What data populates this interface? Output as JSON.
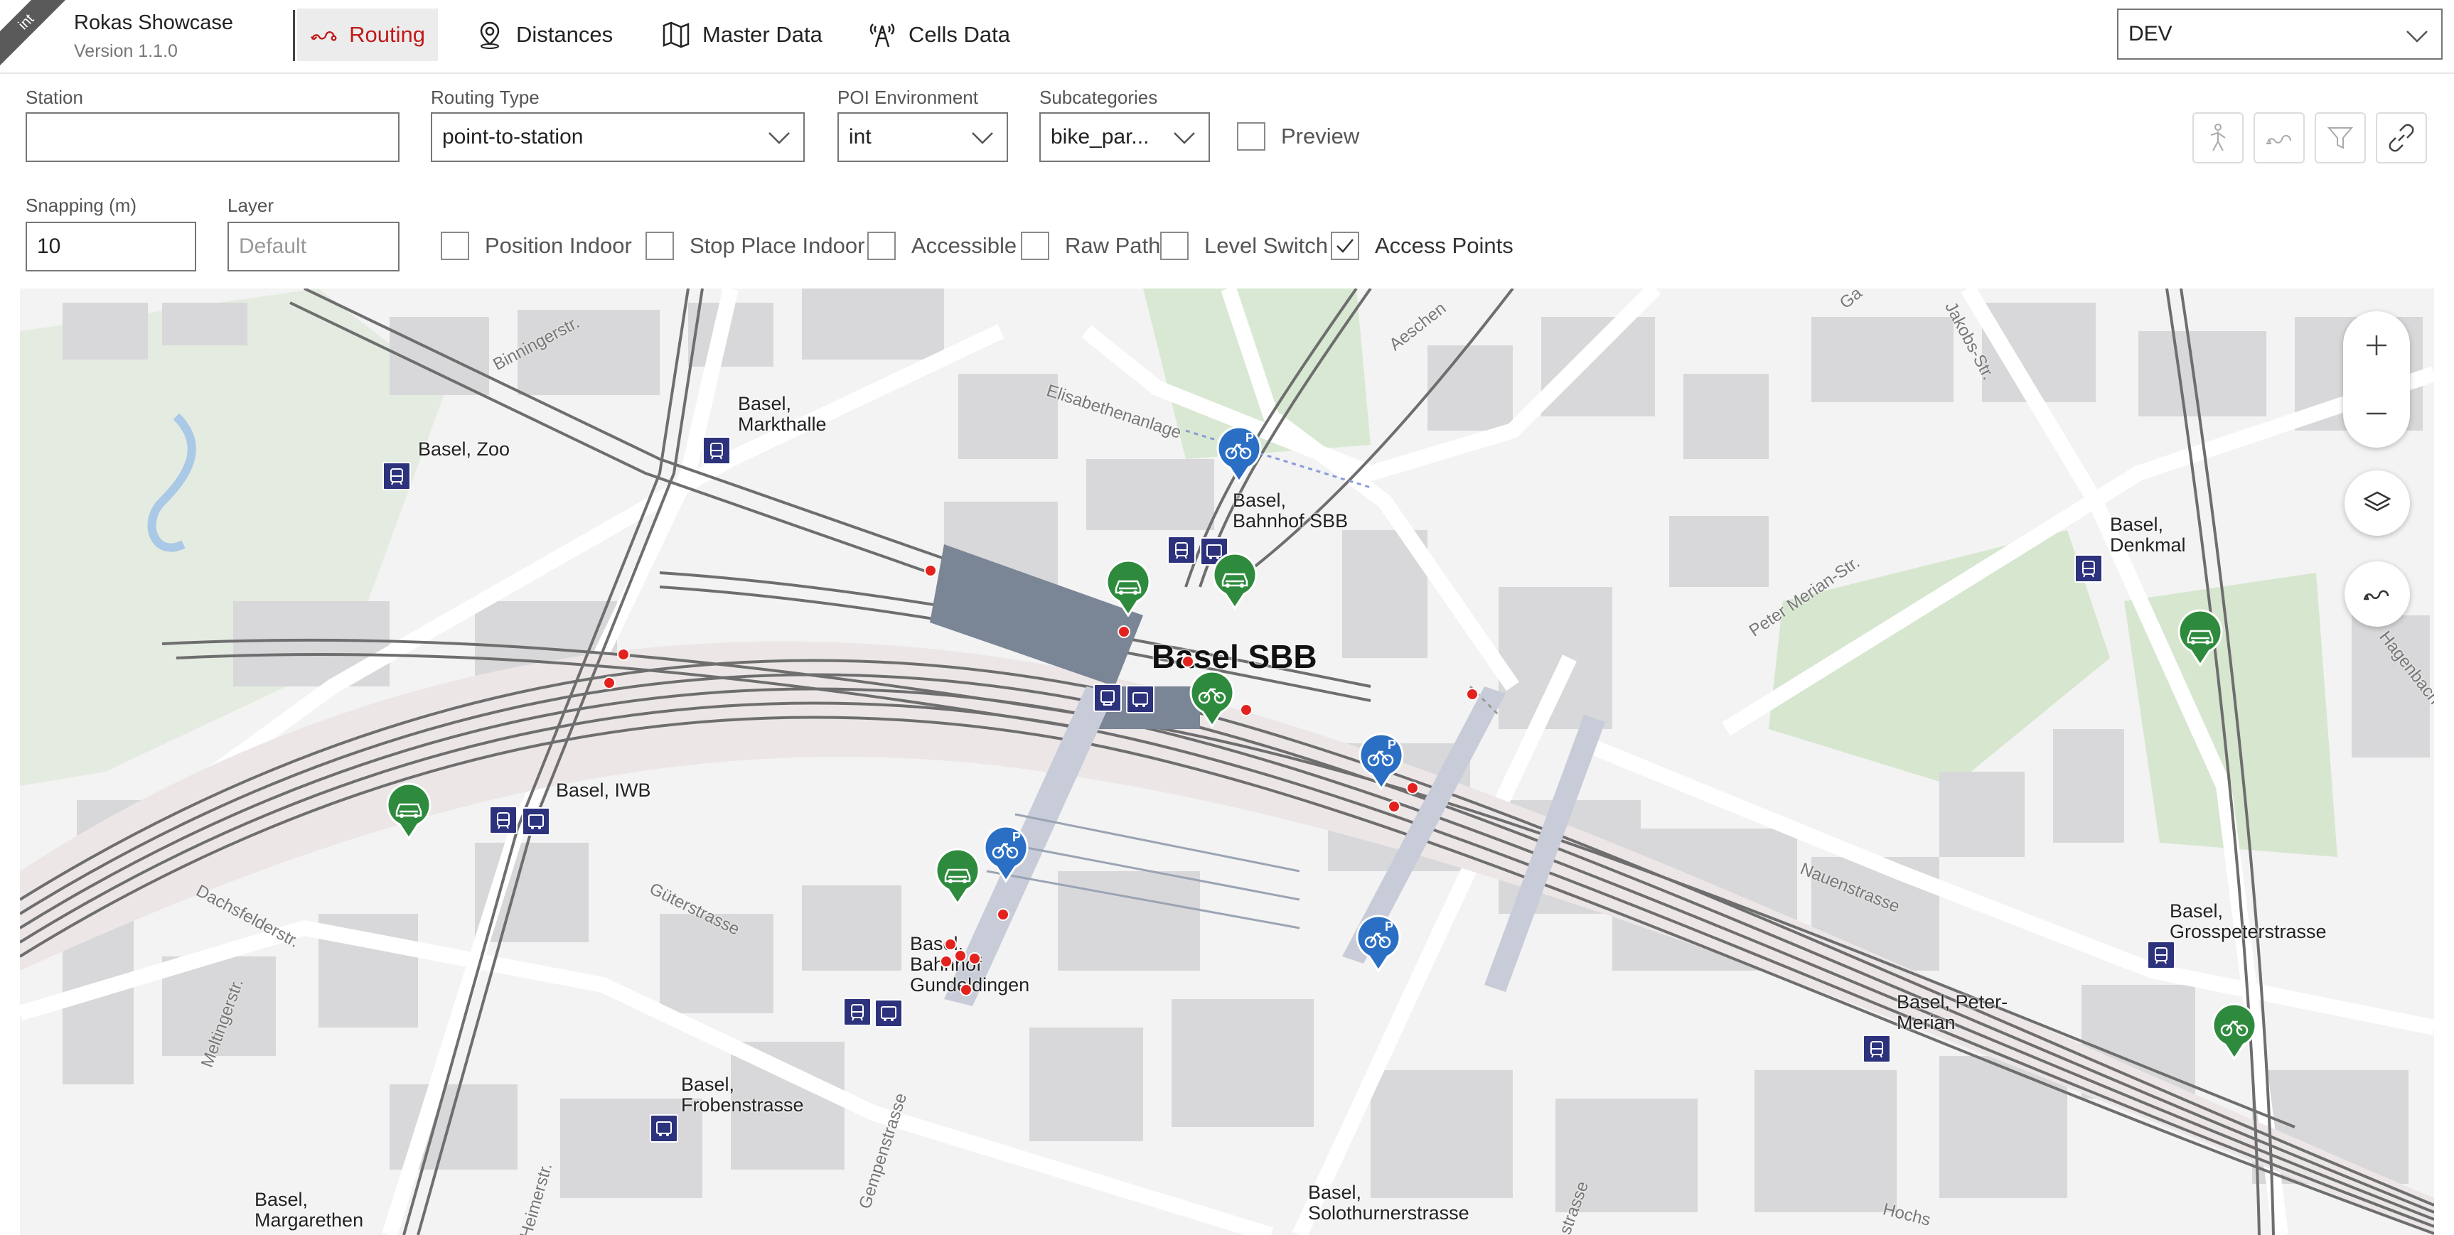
{
  "app": {
    "env_badge": "int",
    "title": "Rokas Showcase",
    "version": "Version 1.1.0"
  },
  "nav": {
    "routing": "Routing",
    "distances": "Distances",
    "master_data": "Master Data",
    "cells_data": "Cells Data"
  },
  "env_select": {
    "value": "DEV"
  },
  "form": {
    "station": {
      "label": "Station",
      "value": ""
    },
    "routing_type": {
      "label": "Routing Type",
      "value": "point-to-station"
    },
    "poi_environment": {
      "label": "POI Environment",
      "value": "int"
    },
    "subcategories": {
      "label": "Subcategories",
      "value": "bike_par..."
    },
    "preview": {
      "label": "Preview",
      "checked": false
    },
    "snapping": {
      "label": "Snapping (m)",
      "value": "10"
    },
    "layer": {
      "label": "Layer",
      "placeholder": "Default"
    },
    "checkboxes": {
      "position_indoor": {
        "label": "Position Indoor",
        "checked": false
      },
      "stop_place_indoor": {
        "label": "Stop Place Indoor",
        "checked": false
      },
      "accessible": {
        "label": "Accessible",
        "checked": false
      },
      "raw_path": {
        "label": "Raw Path",
        "checked": false
      },
      "level_switch": {
        "label": "Level Switch",
        "checked": false
      },
      "access_points": {
        "label": "Access Points",
        "checked": true
      }
    }
  },
  "toolbar_icons": [
    "pedestrian-icon",
    "route-icon",
    "filter-icon",
    "link-icon"
  ],
  "map": {
    "main_station": "Basel SBB",
    "stations": {
      "zoo": "Basel, Zoo",
      "markthalle": "Basel,\nMarkthalle",
      "bahnhof_sbb": "Basel,\nBahnhof SBB",
      "denkmal": "Basel,\nDenkmal",
      "iwb": "Basel, IWB",
      "gundeldingen": "Basel,\nBahnhof\nGundeldingen",
      "frobenstrasse": "Basel,\nFrobenstrasse",
      "margarethen": "Basel,\nMargarethen",
      "solothurnerstrasse": "Basel,\nSolothurnerstrasse",
      "peter_merian": "Basel, Peter-\nMerian",
      "grosspeterstrasse": "Basel,\nGrosspeterstrasse"
    },
    "streets": {
      "binningerstr": "Binningerstr.",
      "elisabethenanlage": "Elisabethenanlage",
      "aeschen": "Aeschen",
      "jakobs": "Jakobs-Str.",
      "peter_merian_str": "Peter Merian-Str.",
      "hagenbach": "Hagenbach",
      "nauenstrasse": "Nauenstrasse",
      "dachsfelderstr": "Dachsfelderstr.",
      "gueterstrasse": "Güterstrasse",
      "meltingerstr": "Meltingerstr.",
      "gempenstrasse": "Gempenstrasse",
      "heimerstr": "Heimerstr.",
      "hochstr": "Hochs",
      "strasse": "strasse",
      "ga": "Ga"
    },
    "colors": {
      "pin_blue": "#2a6fc4",
      "pin_green": "#2e8b3d",
      "access_point": "#e3221e",
      "stop_badge": "#2d327d",
      "active_nav": "#c01a1a"
    }
  }
}
